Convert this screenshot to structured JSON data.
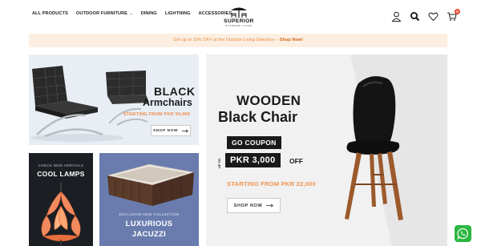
{
  "nav": {
    "items": [
      "ALL PRODUCTS",
      "OUTDOOR FURNITURE",
      "DINING",
      "LIGHTNING",
      "ACCESSORIES"
    ],
    "dropdown_caret": "⌄"
  },
  "logo": {
    "name": "SUPERIOR",
    "tagline": "OUTDOOR LIVING"
  },
  "header_icons": [
    "user-icon",
    "search-icon",
    "heart-icon",
    "cart-icon"
  ],
  "cart_count": "0",
  "promo": {
    "text": "Get up to 10% OFF at the Outdoor Living Selection – ",
    "link": "Shop Now!"
  },
  "banners": {
    "armchairs": {
      "title_line1": "BLACK",
      "title_line2": "Armchairs",
      "price": "STARTING FROM PKR 54,000",
      "button": "SHOP NOW"
    },
    "lamps": {
      "subtitle": "CHECK NEW ARRIVALS",
      "title": "COOL LAMPS"
    },
    "jacuzzi": {
      "subtitle": "EXCLUSIVE NEW COLLECTION",
      "title_line1": "LUXURIOUS",
      "title_line2": "JACUZZI"
    },
    "wooden_chair": {
      "title_line1": "WOODEN",
      "title_line2": "Black Chair",
      "coupon_label": "GO COUPON",
      "up_to": "UP TO",
      "amount": "PKR 3,000",
      "off": "OFF",
      "price": "STARTING FROM PKR 22,000",
      "button": "SHOP NOW"
    }
  },
  "colors": {
    "accent": "#f08c4a",
    "promo_bg": "#fcefe2",
    "lamps_bg": "#1b1f24",
    "jacuzzi_bg": "#6a7cae",
    "whatsapp": "#2bb741",
    "badge": "#e94b35"
  }
}
